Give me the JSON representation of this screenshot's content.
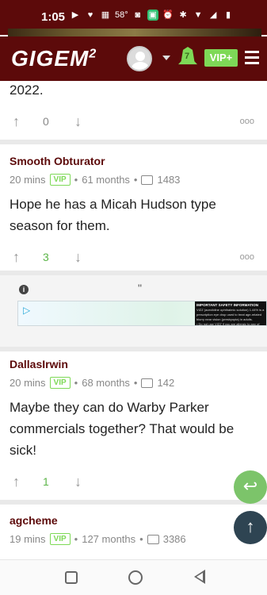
{
  "status_bar": {
    "time": "1:05",
    "temperature": "58°",
    "icons": [
      "youtube-icon",
      "heart-icon",
      "qr-icon",
      "camera-icon",
      "app-icon",
      "alarm-icon",
      "bluetooth-icon",
      "wifi-icon",
      "signal-icon",
      "battery-icon"
    ]
  },
  "header": {
    "logo": "GIGEM",
    "logo_sup": "2",
    "notification_count": "7",
    "vip_label": "VIP+"
  },
  "posts": [
    {
      "body": "2022.",
      "vote_count": "0"
    },
    {
      "username": "Smooth Obturator",
      "time": "20 mins",
      "badge": "VIP",
      "tenure": "61 months",
      "post_count": "1483",
      "body": "Hope he has a Micah Hudson type season for them.",
      "vote_count": "3"
    },
    {
      "username": "DallasIrwin",
      "time": "20 mins",
      "badge": "VIP",
      "tenure": "68 months",
      "post_count": "142",
      "body": "Maybe they can do Warby Parker commercials together? That would be sick!",
      "vote_count": "1"
    },
    {
      "username": "agcheme",
      "time": "19 mins",
      "badge": "VIP",
      "tenure": "127 months",
      "post_count": "3386"
    }
  ],
  "ad": {
    "quote_mark": "\"",
    "info": "i",
    "heading": "IMPORTANT SAFETY INFORMATION",
    "line1": "VIZZ (aceclidine ophthalmic solution) 1.44% is a prescription eye drop used to treat age-related blurry near vision (presbyopia) in adults.",
    "line2": "• Do not use VIZZ if you are allergic to any of"
  },
  "separator": "•",
  "more_label": "ooo",
  "colors": {
    "brand": "#5c0a0a",
    "accent_green": "#7ed957",
    "fab_green": "#7cc46a",
    "fab_dark": "#2e4452"
  }
}
